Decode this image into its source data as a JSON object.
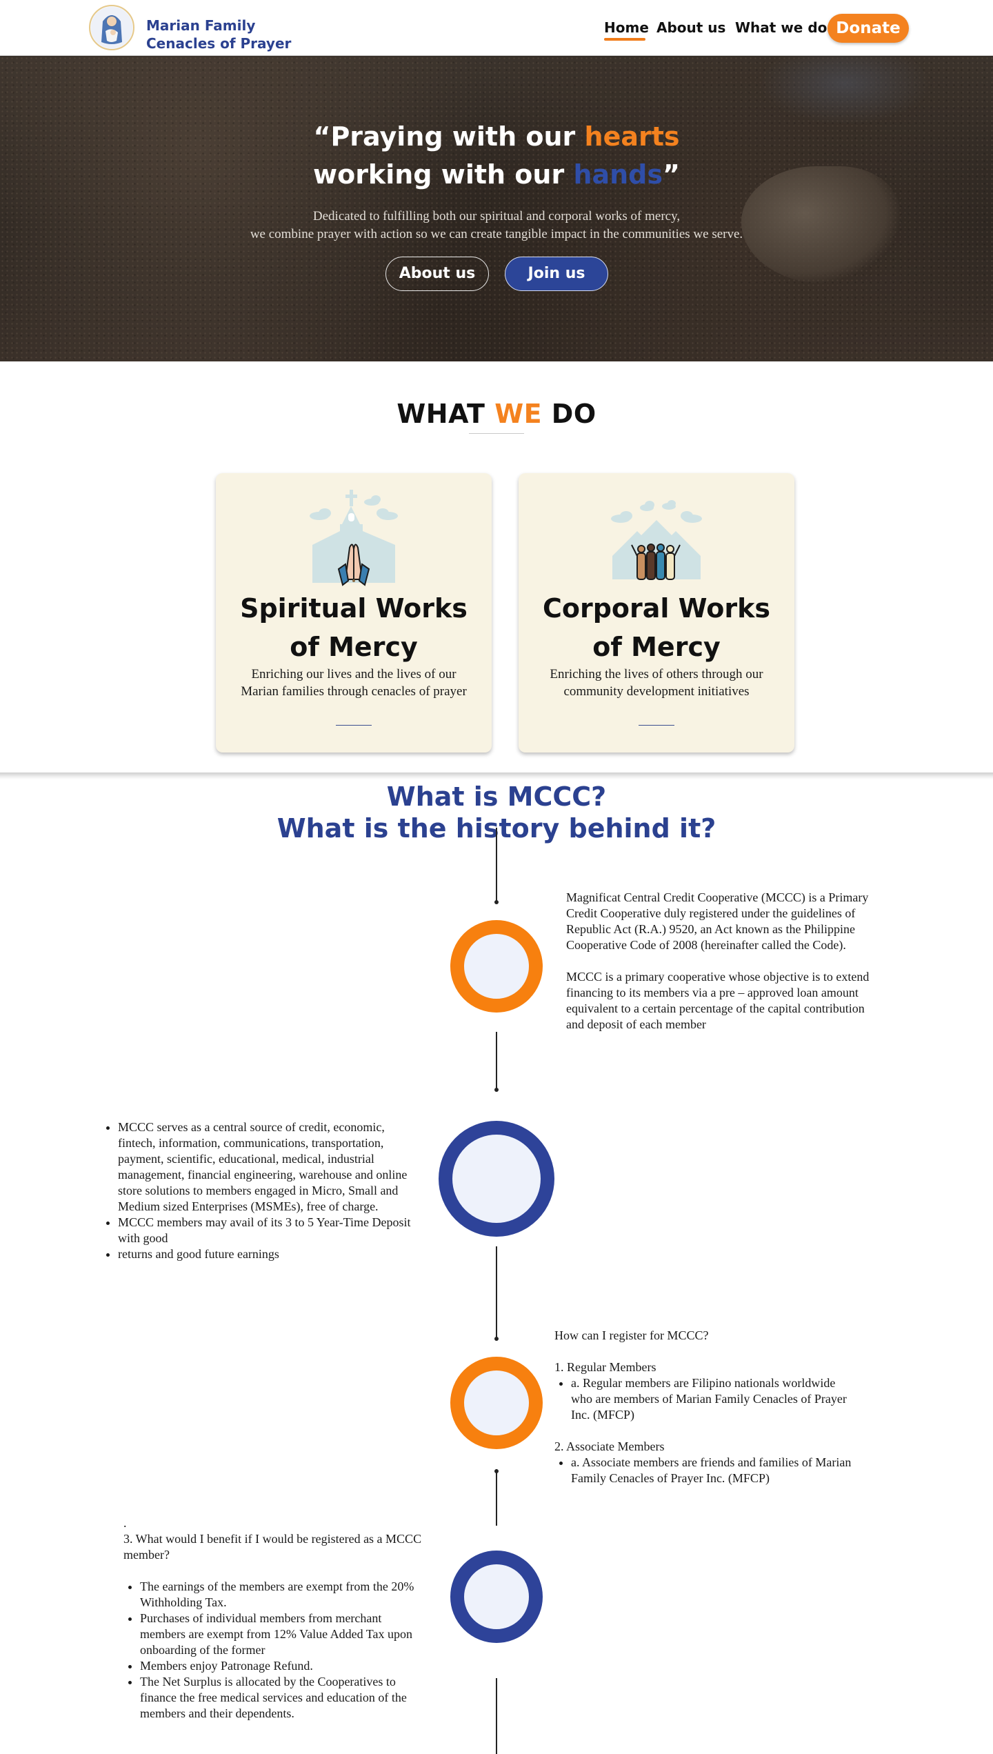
{
  "header": {
    "logo_line1": "Marian Family",
    "logo_line2": "Cenacles of Prayer",
    "nav": {
      "home": "Home",
      "about": "About us",
      "what": "What we do"
    },
    "donate": "Donate"
  },
  "hero": {
    "title_l1_a": "“Praying with our ",
    "title_l1_b": "hearts",
    "title_l2_a": "working with our ",
    "title_l2_b": "hands",
    "title_l2_c": "”",
    "sub_l1": "Dedicated to fulfilling both our spiritual and corporal works of mercy,",
    "sub_l2": "we combine prayer with action so we can create tangible impact in the communities we serve.",
    "btn_about": "About us",
    "btn_join": "Join us"
  },
  "what_we_do": {
    "title_a": "WHAT ",
    "title_b": "WE",
    "title_c": " DO",
    "cards": [
      {
        "title_l1": "Spiritual Works",
        "title_l2": "of Mercy",
        "desc": "Enriching our lives and the lives of our Marian families through cenacles of prayer",
        "icon": "church-praying-hands-icon"
      },
      {
        "title_l1": "Corporal Works",
        "title_l2": "of Mercy",
        "desc": "Enriching the lives of others through our community development initiatives",
        "icon": "community-houses-icon"
      }
    ]
  },
  "mccc": {
    "title_l1": "What is MCCC?",
    "title_l2": "What is the history behind it?",
    "block1_p1": "Magnificat Central Credit Cooperative (MCCC) is a Primary Credit Cooperative duly registered under the guidelines of Republic Act (R.A.) 9520, an Act known as the Philippine Cooperative Code of 2008 (hereinafter called the Code).",
    "block1_p2": "MCCC is a primary cooperative whose objective is to extend financing to its members via a pre – approved loan amount equivalent to a certain percentage of the capital contribution and deposit of each member",
    "block2_items": [
      "MCCC serves as a central source of credit, economic, fintech, information, communications, transportation, payment, scientific, educational, medical, industrial management, financial engineering, warehouse and online store solutions to members engaged in Micro, Small and Medium sized Enterprises (MSMEs), free of charge.",
      "MCCC members may avail of its 3 to 5 Year-Time Deposit with good",
      "returns and good future earnings"
    ],
    "block3_q": "How can I register for MCCC?",
    "block3_h1": "1. Regular Members",
    "block3_i1": "a. Regular members are Filipino nationals worldwide who are members of Marian Family Cenacles of Prayer Inc. (MFCP)",
    "block3_h2": "2. Associate Members",
    "block3_i2": "a. Associate members are friends and families of Marian Family Cenacles of Prayer Inc. (MFCP)",
    "block4_dot": ".",
    "block4_q": "3. What would I benefit if I would be registered as a MCCC member?",
    "block4_items": [
      "The earnings of the members are exempt from the 20% Withholding Tax.",
      "Purchases of individual members from merchant members are exempt from 12% Value Added Tax upon onboarding of the former",
      "Members enjoy Patronage Refund.",
      "The Net Surplus is allocated by the Cooperatives to finance the free medical services and education of the members and their dependents."
    ]
  },
  "colors": {
    "orange": "#f4821f",
    "blue": "#2b4190",
    "card_bg": "#f8f3e3"
  }
}
